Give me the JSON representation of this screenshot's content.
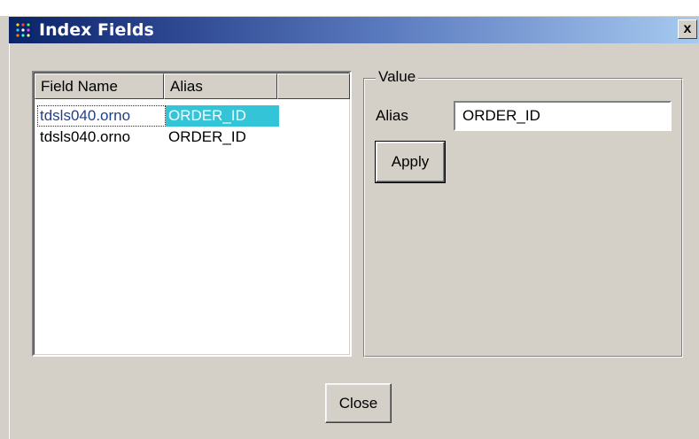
{
  "window": {
    "title": "Index Fields",
    "close_glyph": "x",
    "icon": "grid-dots-icon",
    "title_gradient": [
      "#0a246a",
      "#a6caf0"
    ]
  },
  "list": {
    "columns": [
      "Field Name",
      "Alias",
      ""
    ],
    "rows": [
      {
        "field_name": "tdsls040.orno",
        "alias": "ORDER_ID",
        "selected": true
      },
      {
        "field_name": "tdsls040.orno",
        "alias": "ORDER_ID",
        "selected": false
      }
    ],
    "selection_color": "#33c4d8"
  },
  "value_group": {
    "legend": "Value",
    "alias_label": "Alias",
    "alias_value": "ORDER_ID",
    "apply_label": "Apply"
  },
  "footer": {
    "close_label": "Close"
  }
}
